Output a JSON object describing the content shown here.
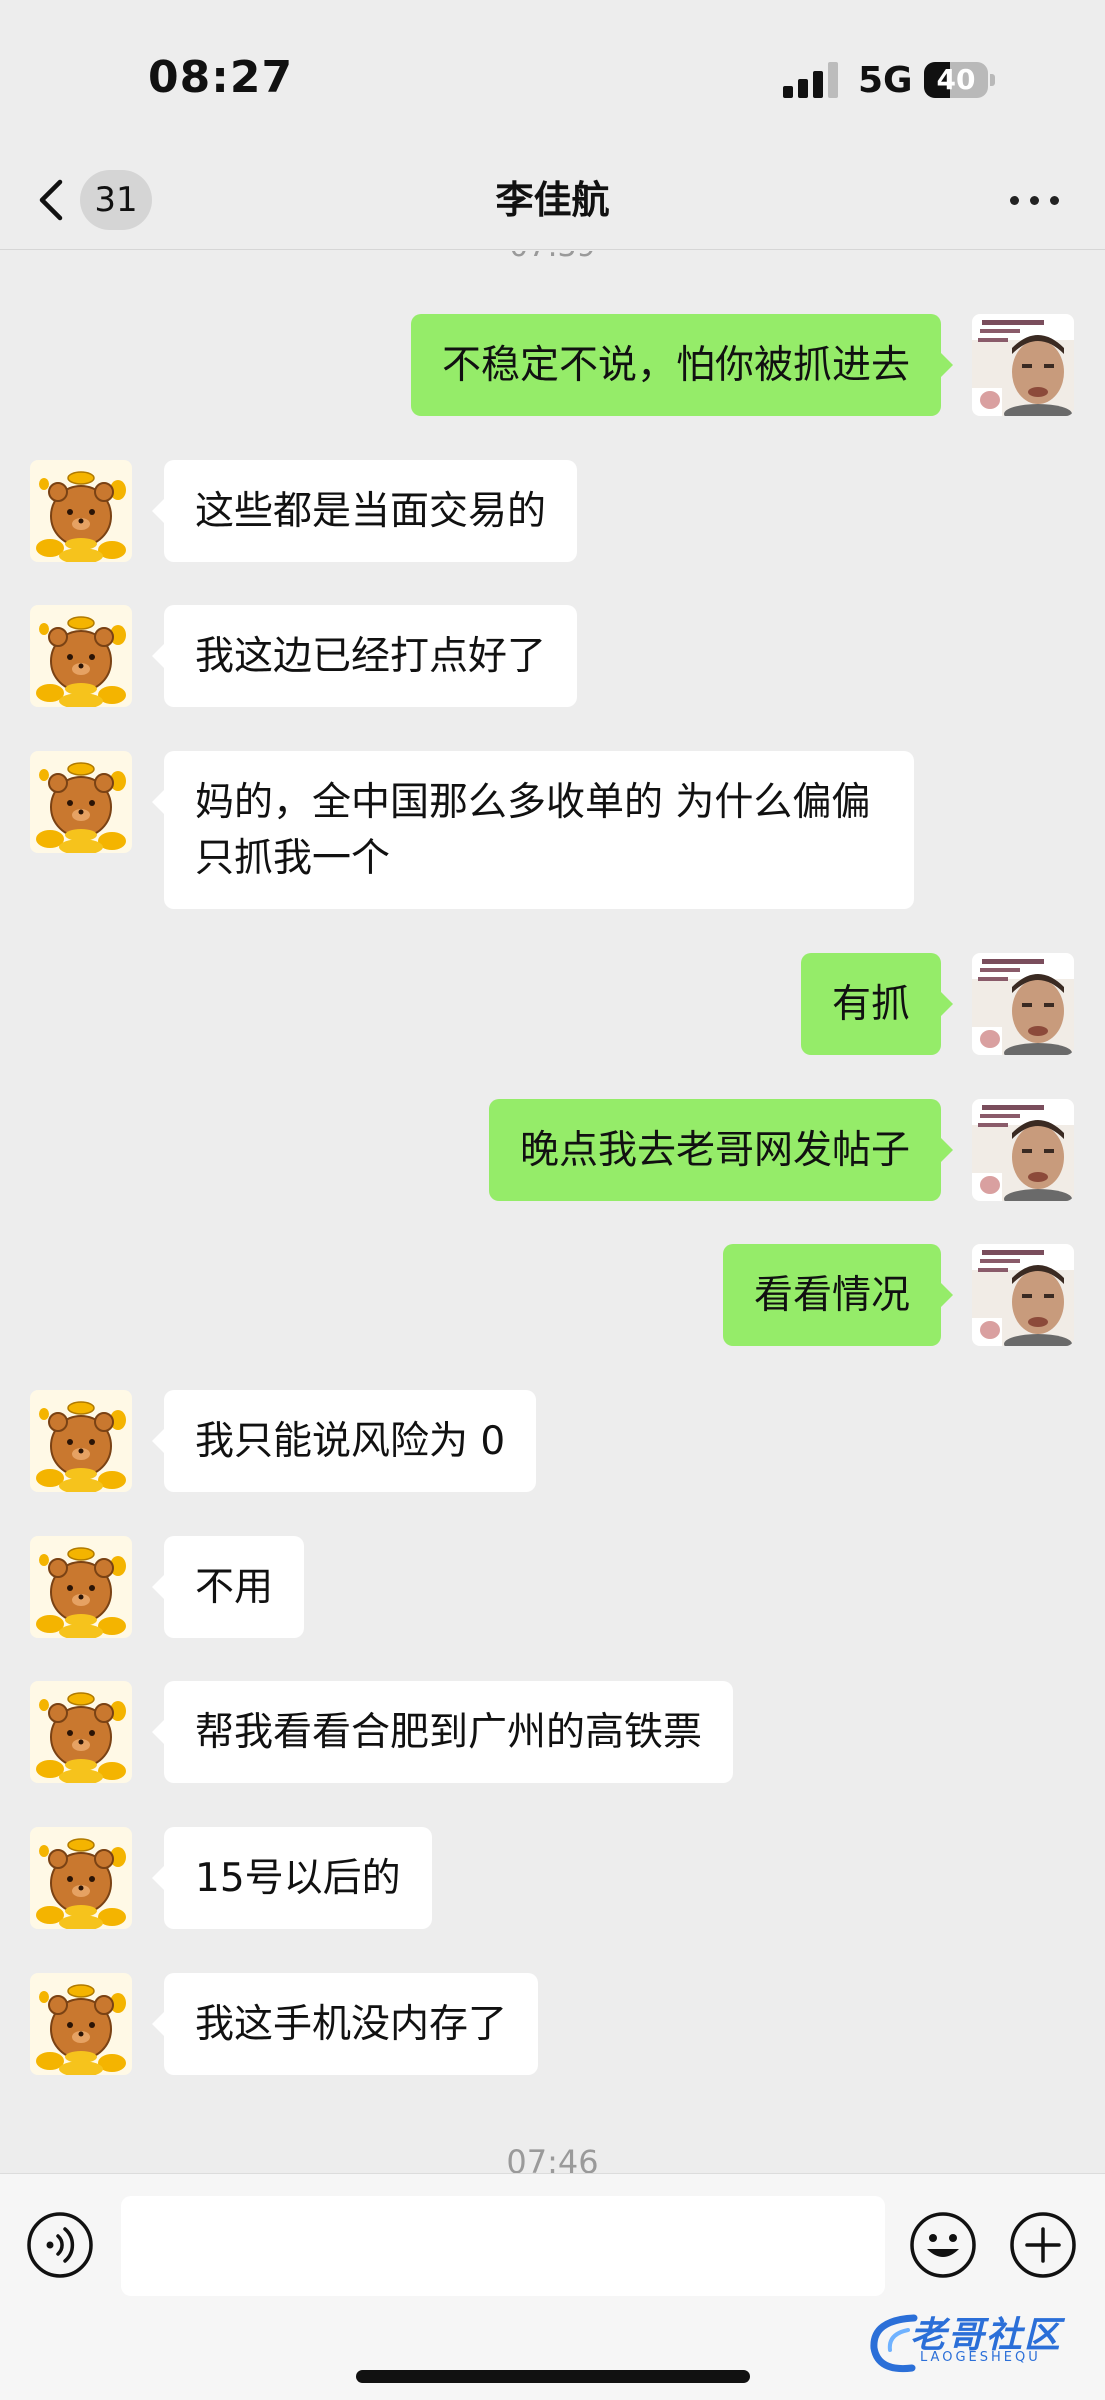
{
  "status_bar": {
    "time": "08:27",
    "network": "5G",
    "battery": "40",
    "battery_level": 0.4
  },
  "nav": {
    "unread_count": "31",
    "title": "李佳航"
  },
  "chat": {
    "partial_timestamp": "07:39",
    "bottom_timestamp": "07:46",
    "messages": [
      {
        "side": "out",
        "text": "不稳定不说，怕你被抓进去"
      },
      {
        "side": "in",
        "text": "这些都是当面交易的"
      },
      {
        "side": "in",
        "text": "我这边已经打点好了"
      },
      {
        "side": "in",
        "text": "妈的，全中国那么多收单的 为什么偏偏只抓我一个"
      },
      {
        "side": "out",
        "text": "有抓"
      },
      {
        "side": "out",
        "text": "晚点我去老哥网发帖子"
      },
      {
        "side": "out",
        "text": "看看情况"
      },
      {
        "side": "in",
        "text": "我只能说风险为 0"
      },
      {
        "side": "in",
        "text": "不用"
      },
      {
        "side": "in",
        "text": "帮我看看合肥到广州的高铁票"
      },
      {
        "side": "in",
        "text": "15号以后的"
      },
      {
        "side": "in",
        "text": "我这手机没内存了"
      }
    ]
  },
  "input": {
    "placeholder": ""
  },
  "watermark": {
    "text": "老哥社区",
    "sub": "LAOGESHEQU"
  },
  "colors": {
    "outgoing_bubble": "#95ec69",
    "incoming_bubble": "#ffffff",
    "background": "#ededed"
  },
  "icons": [
    "back-chevron-icon",
    "more-dots-icon",
    "voice-icon",
    "emoji-icon",
    "plus-icon"
  ]
}
